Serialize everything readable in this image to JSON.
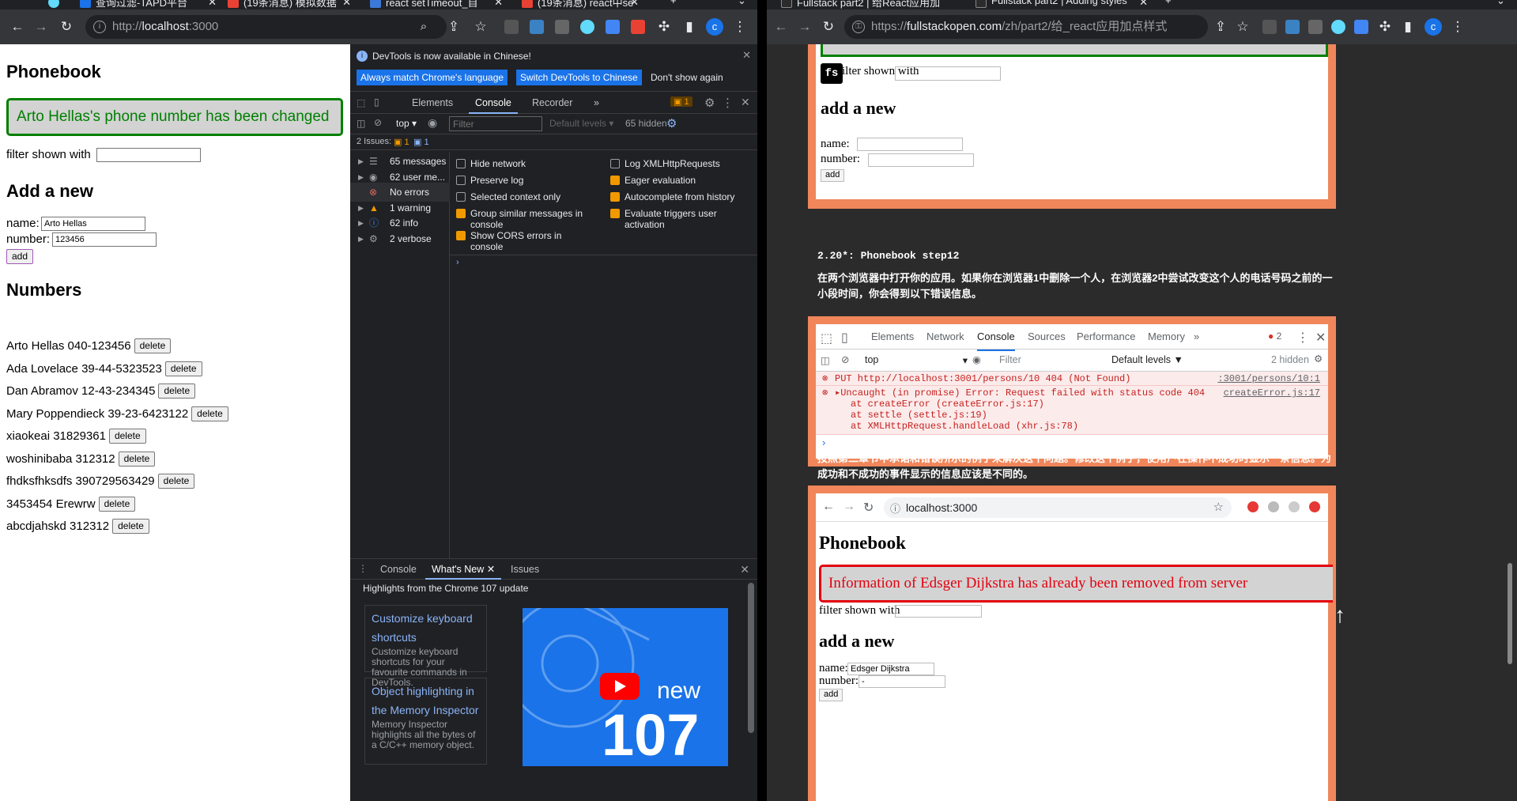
{
  "left_window": {
    "tabs": [
      {
        "title": "查询过滤-TAPD平台",
        "color": "#1a73e8"
      },
      {
        "title": "(19条消息) 模拟数据",
        "color": "#e94234"
      },
      {
        "title": "react setTimeout_自",
        "color": "#3c78d8"
      },
      {
        "title": "(19条消息) react中se",
        "color": "#e94234"
      }
    ],
    "url_prefix": "http://",
    "url_host": "localhost",
    "url_port": ":3000",
    "avatar": "c"
  },
  "app": {
    "title": "Phonebook",
    "notification": "Arto Hellas's phone number has been changed",
    "filter_label": "filter shown with",
    "filter_value": "",
    "add_heading": "Add a new",
    "name_label": "name:",
    "name_value": "Arto Hellas",
    "number_label": "number:",
    "number_value": "123456",
    "add_button": "add",
    "numbers_heading": "Numbers",
    "delete_label": "delete",
    "persons": [
      "Arto Hellas 040-123456",
      "Ada Lovelace 39-44-5323523",
      "Dan Abramov 12-43-234345",
      "Mary Poppendieck 39-23-6423122",
      "xiaokeai 31829361",
      "woshinibaba 312312",
      "fhdksfhksdfs 390729563429",
      "3453454 Erewrw",
      "abcdjahskd 312312"
    ]
  },
  "devtools": {
    "banner_text": "DevTools is now available in Chinese!",
    "banner_btn1": "Always match Chrome's language",
    "banner_btn2": "Switch DevTools to Chinese",
    "banner_btn3": "Don't show again",
    "tabs": [
      "Elements",
      "Console",
      "Recorder"
    ],
    "issues_badge": "1",
    "context": "top",
    "filter_placeholder": "Filter",
    "levels": "Default levels",
    "hidden": "65 hidden",
    "issues_bar": "2 Issues:",
    "issues_warn": "1",
    "issues_info": "1",
    "sidebar": [
      {
        "label": "65 messages",
        "icon": "list-icon",
        "color": "#9aa0a6"
      },
      {
        "label": "62 user me...",
        "icon": "user-icon",
        "color": "#9aa0a6"
      },
      {
        "label": "No errors",
        "icon": "error-icon",
        "color": "#e46962"
      },
      {
        "label": "1 warning",
        "icon": "warning-icon",
        "color": "#f29900"
      },
      {
        "label": "62 info",
        "icon": "info-icon",
        "color": "#4285f4"
      },
      {
        "label": "2 verbose",
        "icon": "gear-icon",
        "color": "#9aa0a6"
      }
    ],
    "settings_left": [
      {
        "label": "Hide network",
        "checked": false
      },
      {
        "label": "Preserve log",
        "checked": false
      },
      {
        "label": "Selected context only",
        "checked": false
      },
      {
        "label": "Group similar messages in console",
        "checked": true
      },
      {
        "label": "Show CORS errors in console",
        "checked": true
      }
    ],
    "settings_right": [
      {
        "label": "Log XMLHttpRequests",
        "checked": false
      },
      {
        "label": "Eager evaluation",
        "checked": true
      },
      {
        "label": "Autocomplete from history",
        "checked": true
      },
      {
        "label": "Evaluate triggers user activation",
        "checked": true
      }
    ],
    "drawer_tabs": [
      "Console",
      "What's New",
      "Issues"
    ],
    "drawer_heading": "Highlights from the Chrome 107 update",
    "cards": [
      {
        "title": "Customize keyboard shortcuts",
        "desc": "Customize keyboard shortcuts for your favourite commands in DevTools."
      },
      {
        "title": "Object highlighting in the Memory Inspector",
        "desc": "Memory Inspector highlights all the bytes of a C/C++ memory object."
      }
    ],
    "video_new": "new",
    "video_num": "107"
  },
  "right_window": {
    "tabs": [
      {
        "title": "Fullstack part2 | 给React应用加"
      },
      {
        "title": "Fullstack part2 | Adding styles"
      }
    ],
    "url_prefix": "https://",
    "url_host": "fullstackopen.com",
    "url_path": "/zh/part2/给_react应用加点样式",
    "avatar": "c",
    "fs_badge": "fs",
    "shot1": {
      "filter_label": "filter shown with",
      "add_heading": "add a new",
      "name_label": "name:",
      "number_label": "number:",
      "add_button": "add"
    },
    "exercise_title": "2.20*: Phonebook step12",
    "exercise_text": "在两个浏览器中打开你的应用。如果你在浏览器1中删除一个人，在浏览器2中尝试改变这个人的电话号码之前的一小段时间，你会得到以下错误信息。",
    "console_shot": {
      "tabs": [
        "Elements",
        "Network",
        "Console",
        "Sources",
        "Performance",
        "Memory"
      ],
      "error_count": "2",
      "context": "top",
      "filter": "Filter",
      "levels": "Default levels ▼",
      "hidden": "2 hidden",
      "err1": "PUT http://localhost:3001/persons/10 404 (Not Found)",
      "err1_src": ":3001/persons/10:1",
      "err2": "▸Uncaught (in promise) Error: Request failed with status code 404",
      "err2_src": "createError.js:17",
      "stack": [
        "at createError (createError.js:17)",
        "at settle (settle.js:19)",
        "at XMLHttpRequest.handleLoad (xhr.js:78)"
      ]
    },
    "para2": "按照第二章节中承诺和错误所示的例子来解决这个问题。修改这个例子，使用户在操作不成功时显示一条信息。为成功和不成功的事件显示的信息应该是不同的。",
    "shot2": {
      "url": "localhost:3000",
      "title": "Phonebook",
      "error": "Information of Edsger Dijkstra has already been removed from server",
      "filter_label": "filter shown with",
      "add_heading": "add a new",
      "name_label": "name:",
      "name_value": "Edsger Dijkstra",
      "number_label": "number:",
      "number_value": "-",
      "add_button": "add"
    }
  }
}
